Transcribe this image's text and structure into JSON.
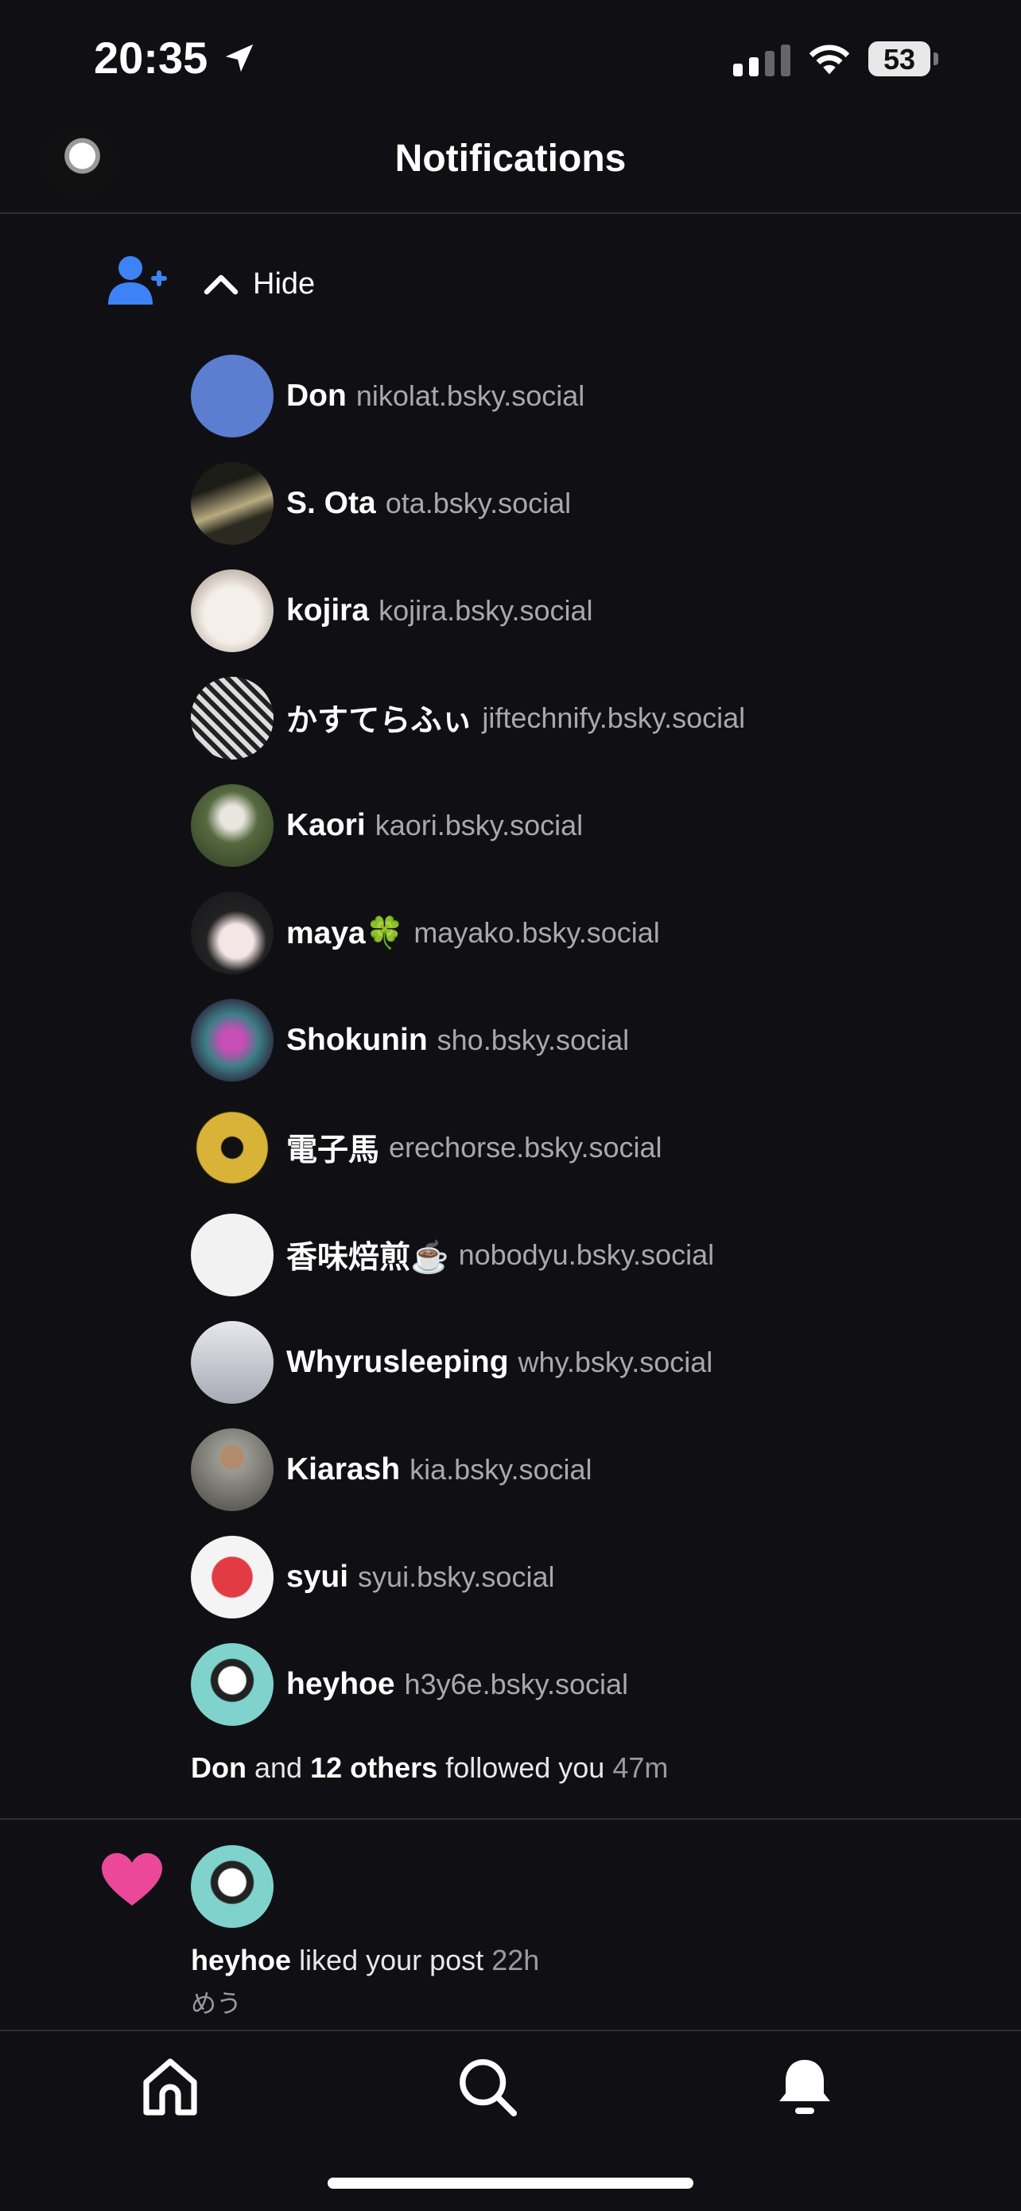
{
  "status_bar": {
    "time": "20:35",
    "battery": "53"
  },
  "header": {
    "title": "Notifications"
  },
  "follow_group": {
    "hide_label": "Hide",
    "followers": [
      {
        "name": "Don",
        "handle": "nikolat.bsky.social",
        "avatar_color": "#5b7ed1"
      },
      {
        "name": "S. Ota",
        "handle": "ota.bsky.social",
        "avatar_color": "#3a3a2a"
      },
      {
        "name": "kojira",
        "handle": "kojira.bsky.social",
        "avatar_color": "#d9cfc4"
      },
      {
        "name": "かすてらふぃ",
        "handle": "jiftechnify.bsky.social",
        "avatar_color": "#555555"
      },
      {
        "name": "Kaori",
        "handle": "kaori.bsky.social",
        "avatar_color": "#6d7a55"
      },
      {
        "name": "maya🍀",
        "handle": "mayako.bsky.social",
        "avatar_color": "#2f2a34"
      },
      {
        "name": "Shokunin",
        "handle": "sho.bsky.social",
        "avatar_color": "#4a2c59"
      },
      {
        "name": "電子馬",
        "handle": "erechorse.bsky.social",
        "avatar_color": "#d8b338"
      },
      {
        "name": "香味焙煎☕️",
        "handle": "nobodyu.bsky.social",
        "avatar_color": "#f2f2f2"
      },
      {
        "name": "Whyrusleeping",
        "handle": "why.bsky.social",
        "avatar_color": "#c9cbd2"
      },
      {
        "name": "Kiarash",
        "handle": "kia.bsky.social",
        "avatar_color": "#8a8a7f"
      },
      {
        "name": "syui",
        "handle": "syui.bsky.social",
        "avatar_color": "#f4f4f4"
      },
      {
        "name": "heyhoe",
        "handle": "h3y6e.bsky.social",
        "avatar_color": "#7fd3cc"
      }
    ],
    "summary": {
      "first": "Don",
      "and": "and",
      "others": "12 others",
      "action": "followed you",
      "time": "47m"
    }
  },
  "like_notification": {
    "user": "heyhoe",
    "action": "liked your post",
    "time": "22h",
    "post_text": "めう",
    "avatar_color": "#7fd3cc"
  },
  "colors": {
    "accent": "#3d83f5",
    "like": "#ec4899",
    "background": "#101014"
  }
}
